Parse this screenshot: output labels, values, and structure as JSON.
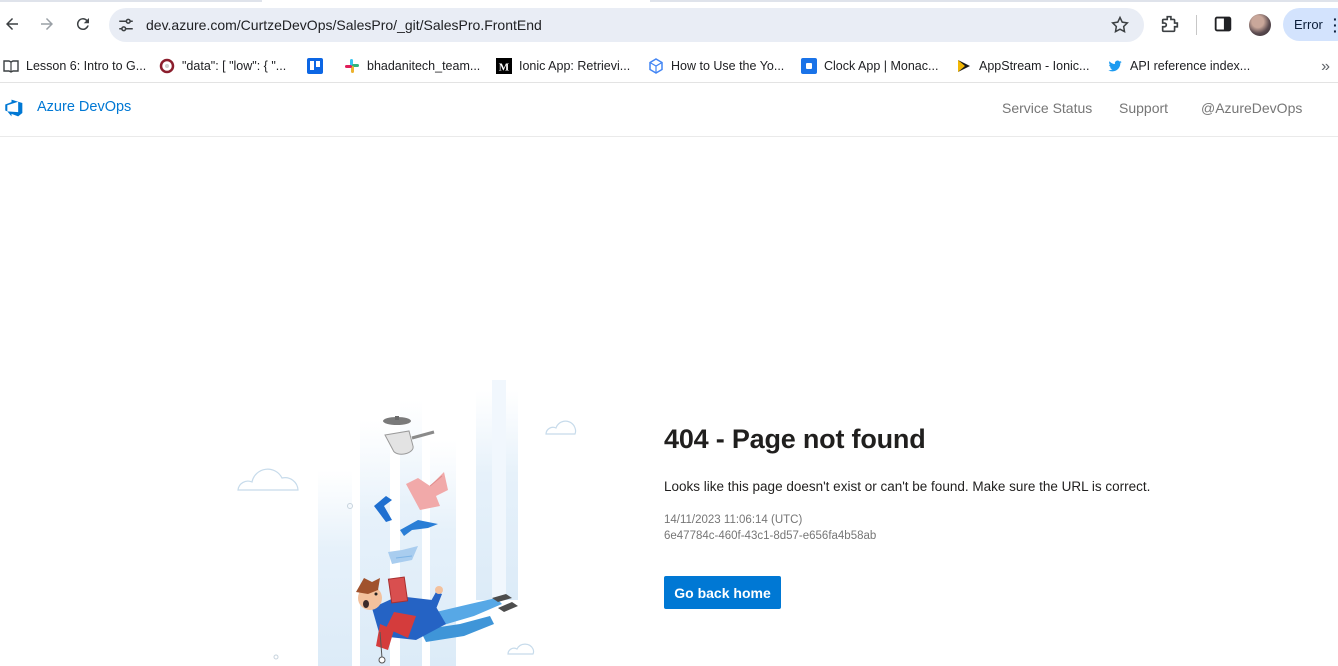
{
  "browser": {
    "url": "dev.azure.com/CurtzeDevOps/SalesPro/_git/SalesPro.FrontEnd",
    "profile_button_label": "Error",
    "icons": [
      "back-icon",
      "forward-icon",
      "reload-icon",
      "site-info-icon",
      "bookmark-star-icon",
      "extensions-icon",
      "side-panel-icon",
      "avatar",
      "more-icon"
    ]
  },
  "bookmarks": {
    "items": [
      {
        "label": "Lesson 6: Intro to G...",
        "icon": "book-icon"
      },
      {
        "label": "\"data\": [ \"low\": { \"...",
        "icon": "circle-icon"
      },
      {
        "label": "",
        "icon": "trello-icon"
      },
      {
        "label": "bhadanitech_team...",
        "icon": "slack-icon"
      },
      {
        "label": "Ionic App: Retrievi...",
        "icon": "medium-icon"
      },
      {
        "label": "How to Use the Yo...",
        "icon": "cube-icon"
      },
      {
        "label": "Clock App | Monac...",
        "icon": "square-app-icon"
      },
      {
        "label": "AppStream - Ionic...",
        "icon": "appstream-icon"
      },
      {
        "label": "API reference index...",
        "icon": "twitter-icon"
      }
    ],
    "more_label": "»"
  },
  "header": {
    "brand": "Azure DevOps",
    "links": [
      "Service Status",
      "Support",
      "@AzureDevOps"
    ]
  },
  "error": {
    "title": "404 - Page not found",
    "description": "Looks like this page doesn't exist or can't be found. Make sure the URL is correct.",
    "timestamp": "14/11/2023 11:06:14 (UTC)",
    "activity_id": "6e47784c-460f-43c1-8d57-e656fa4b58ab",
    "button_label": "Go back home"
  },
  "colors": {
    "accent": "#0078d4",
    "omnibox": "#e9edf5",
    "profile_pill": "#d3e3fd"
  }
}
